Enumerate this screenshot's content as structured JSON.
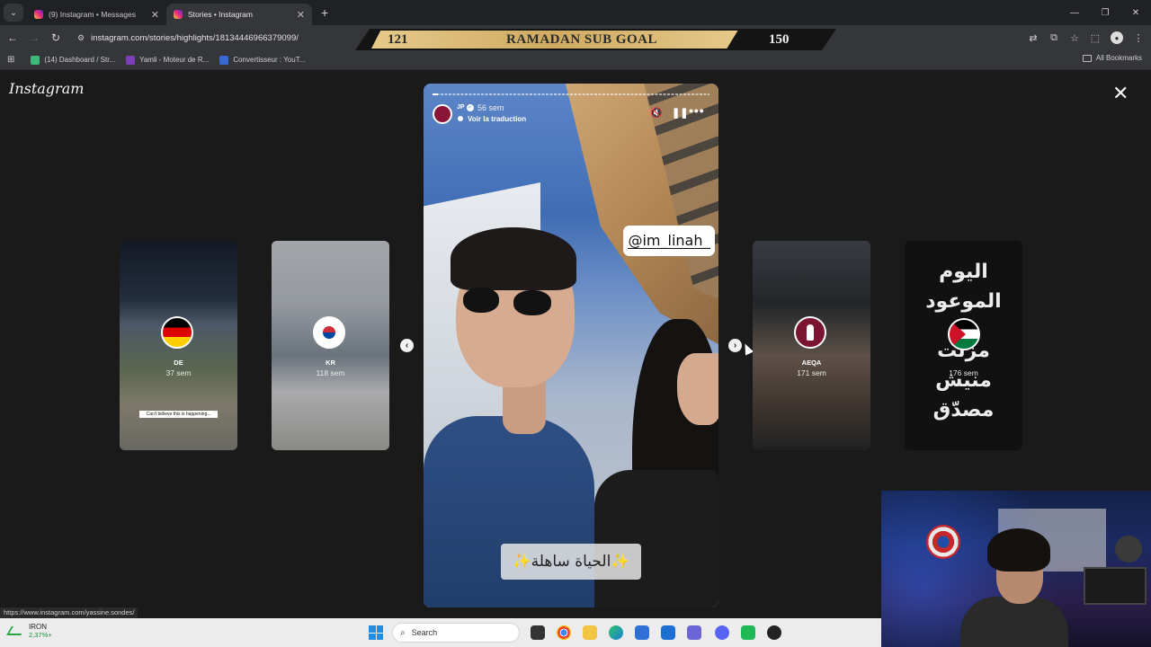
{
  "browser": {
    "tabs": [
      {
        "title": "(9) Instagram • Messages",
        "active": false
      },
      {
        "title": "Stories • Instagram",
        "active": true
      }
    ],
    "url": "instagram.com/stories/highlights/18134446966379099/",
    "bookmarks": [
      {
        "label": "(14) Dashboard / Str...",
        "color": "#3cb878"
      },
      {
        "label": "Yamli - Moteur de R...",
        "color": "#7b3fb6"
      },
      {
        "label": "Convertisseur : YouT...",
        "color": "#3a67d8"
      }
    ],
    "all_bookmarks": "All Bookmarks"
  },
  "goal_banner": {
    "current": "121",
    "title": "RAMADAN SUB GOAL",
    "target": "150",
    "progress": 0.807
  },
  "instagram": {
    "logo": "Instagram",
    "previews": [
      {
        "name": "DE",
        "time": "37 sem",
        "caption": "Can't believe this is happening..."
      },
      {
        "name": "KR",
        "time": "118 sem"
      },
      {
        "name": "AEQA",
        "time": "171 sem"
      },
      {
        "name": "",
        "time": "176 sem",
        "arabic_lines": [
          "اليوم",
          "الموعود",
          "مزّلت",
          "منيش",
          "مصدّق"
        ]
      }
    ],
    "story": {
      "user": "JP",
      "time": "56 sem",
      "translate": "Voir la traduction",
      "mention": "@im_linah_",
      "caption": "✨الحياة ساهلة✨",
      "progress": 0.02
    }
  },
  "status_url": "https://www.instagram.com/yassine.sondes/",
  "taskbar": {
    "ticker_name": "IRON",
    "ticker_value": "2,37%+",
    "search_placeholder": "Search"
  },
  "colors": {
    "ig_bg": "#1a1a1a",
    "goal_gold": "#cfab62",
    "accent_blue": "#3897f0"
  }
}
